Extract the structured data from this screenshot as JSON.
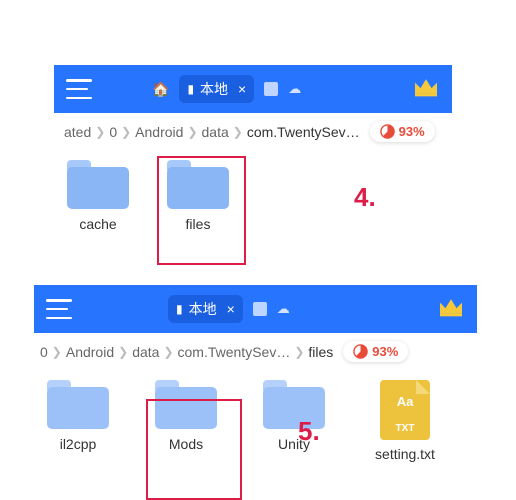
{
  "colors": {
    "toolbar": "#2775ff",
    "accent": "#dd1c48",
    "folder": "#8ab6f5",
    "badge": "#e84b3a"
  },
  "screenshot1": {
    "tab": {
      "label": "本地",
      "icon": "folder"
    },
    "breadcrumb": {
      "items": [
        "ated",
        "0",
        "Android",
        "data",
        "com.TwentySev…"
      ]
    },
    "storage_pct": "93%",
    "items": [
      {
        "name": "cache",
        "type": "folder"
      },
      {
        "name": "files",
        "type": "folder"
      }
    ]
  },
  "screenshot2": {
    "tab": {
      "label": "本地",
      "icon": "folder"
    },
    "breadcrumb": {
      "items": [
        "0",
        "Android",
        "data",
        "com.TwentySev…",
        "files"
      ]
    },
    "storage_pct": "93%",
    "items": [
      {
        "name": "il2cpp",
        "type": "folder"
      },
      {
        "name": "Mods",
        "type": "folder"
      },
      {
        "name": "Unity",
        "type": "folder"
      },
      {
        "name": "setting.txt",
        "type": "txt"
      }
    ]
  },
  "annotations": {
    "step4": "4.",
    "step5": "5."
  },
  "txt_icon": {
    "aa": "Aa",
    "ext": "TXT"
  }
}
